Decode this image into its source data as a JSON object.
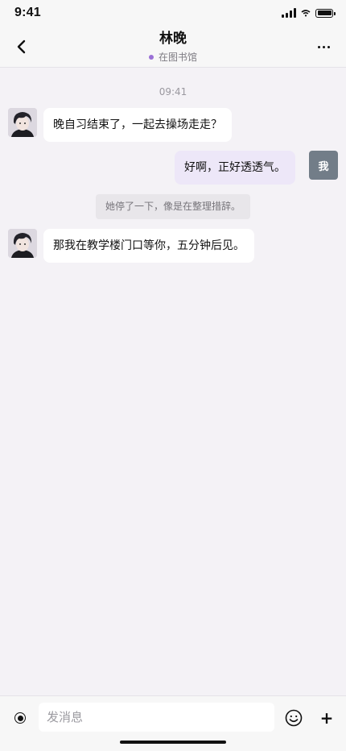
{
  "status_bar": {
    "time": "9:41"
  },
  "header": {
    "back_icon": "chevron-left-icon",
    "contact_name": "林晚",
    "contact_status": "在图书馆",
    "status_dot_color": "#9a70d6",
    "more_icon": "more-horizontal-icon"
  },
  "conversation": {
    "timestamp": "09:41",
    "messages": [
      {
        "sender": "contact",
        "text": "晚自习结束了，一起去操场走走？"
      },
      {
        "sender": "self",
        "text": "好啊，正好透透气。",
        "avatar_label": "我"
      },
      {
        "sender": "narration",
        "text": "她停了一下，像是在整理措辞。"
      },
      {
        "sender": "contact",
        "text": "那我在教学楼门口等你，五分钟后见。"
      }
    ]
  },
  "input_bar": {
    "placeholder": "发消息",
    "voice_icon": "voice-record-icon",
    "emoji_icon": "emoji-icon",
    "plus_label": "+"
  },
  "colors": {
    "background": "#f4f2f6",
    "outgoing_bubble": "#ede7f8",
    "incoming_bubble": "#ffffff",
    "self_avatar": "#727d88"
  }
}
